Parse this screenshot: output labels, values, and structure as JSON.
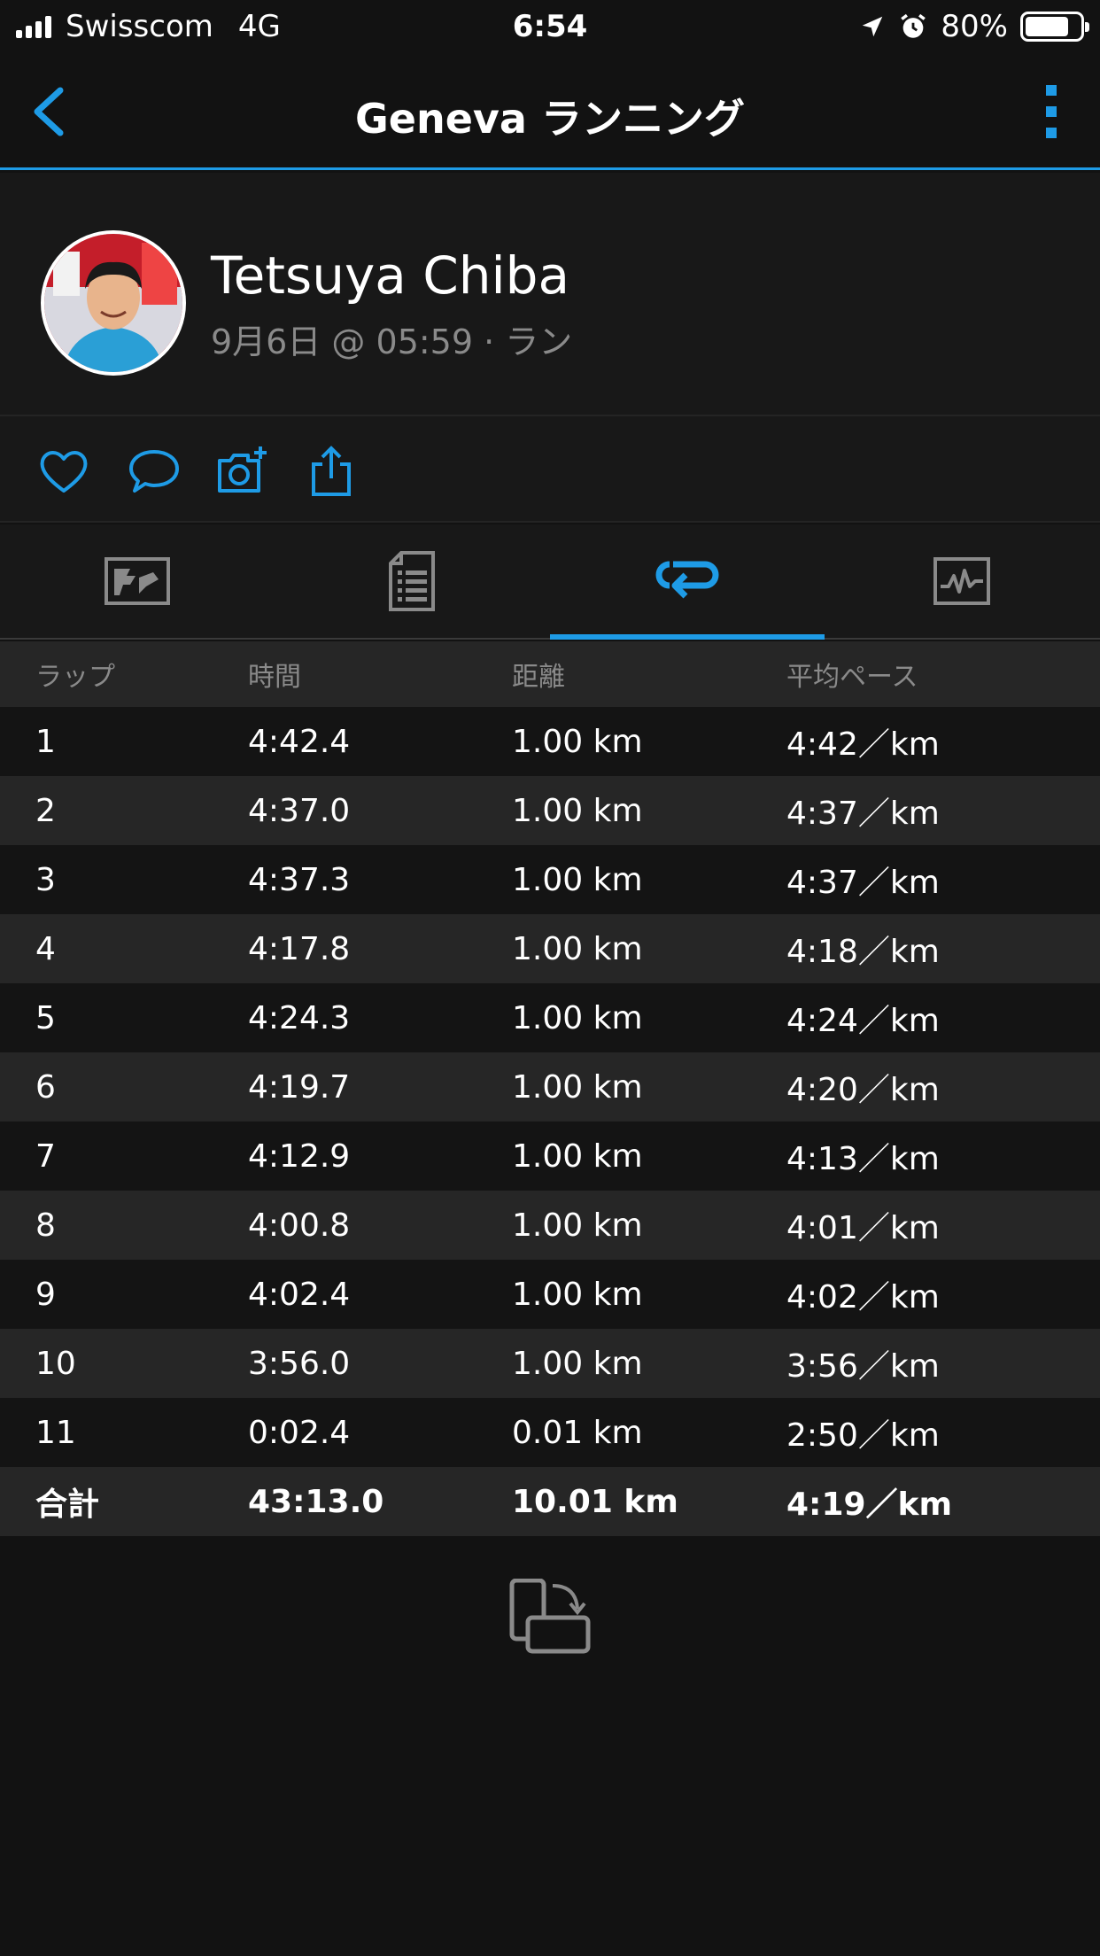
{
  "status_bar": {
    "carrier": "Swisscom",
    "network": "4G",
    "time": "6:54",
    "battery": "80%",
    "battery_level": 0.8
  },
  "nav": {
    "title": "Geneva ランニング",
    "back_icon": "chevron-left-icon",
    "more_icon": "more-vertical-icon"
  },
  "profile": {
    "name": "Tetsuya Chiba",
    "meta": "9月6日 @ 05:59 · ラン"
  },
  "actions": [
    "heart-icon",
    "comment-icon",
    "camera-add-icon",
    "share-icon"
  ],
  "tabs": [
    {
      "icon": "map-icon",
      "active": false
    },
    {
      "icon": "details-icon",
      "active": false
    },
    {
      "icon": "laps-icon",
      "active": true
    },
    {
      "icon": "chart-icon",
      "active": false
    }
  ],
  "laps_table": {
    "headers": [
      "ラップ",
      "時間",
      "距離",
      "平均ペース"
    ],
    "rows": [
      [
        "1",
        "4:42.4",
        "1.00 km",
        "4:42／km"
      ],
      [
        "2",
        "4:37.0",
        "1.00 km",
        "4:37／km"
      ],
      [
        "3",
        "4:37.3",
        "1.00 km",
        "4:37／km"
      ],
      [
        "4",
        "4:17.8",
        "1.00 km",
        "4:18／km"
      ],
      [
        "5",
        "4:24.3",
        "1.00 km",
        "4:24／km"
      ],
      [
        "6",
        "4:19.7",
        "1.00 km",
        "4:20／km"
      ],
      [
        "7",
        "4:12.9",
        "1.00 km",
        "4:13／km"
      ],
      [
        "8",
        "4:00.8",
        "1.00 km",
        "4:01／km"
      ],
      [
        "9",
        "4:02.4",
        "1.00 km",
        "4:02／km"
      ],
      [
        "10",
        "3:56.0",
        "1.00 km",
        "3:56／km"
      ],
      [
        "11",
        "0:02.4",
        "0.01 km",
        "2:50／km"
      ]
    ],
    "total": [
      "合計",
      "43:13.0",
      "10.01 km",
      "4:19／km"
    ]
  },
  "footer": {
    "rotate_icon": "rotate-device-icon"
  },
  "colors": {
    "accent": "#1e9be6",
    "background": "#121212",
    "row_alt": "#262626"
  }
}
